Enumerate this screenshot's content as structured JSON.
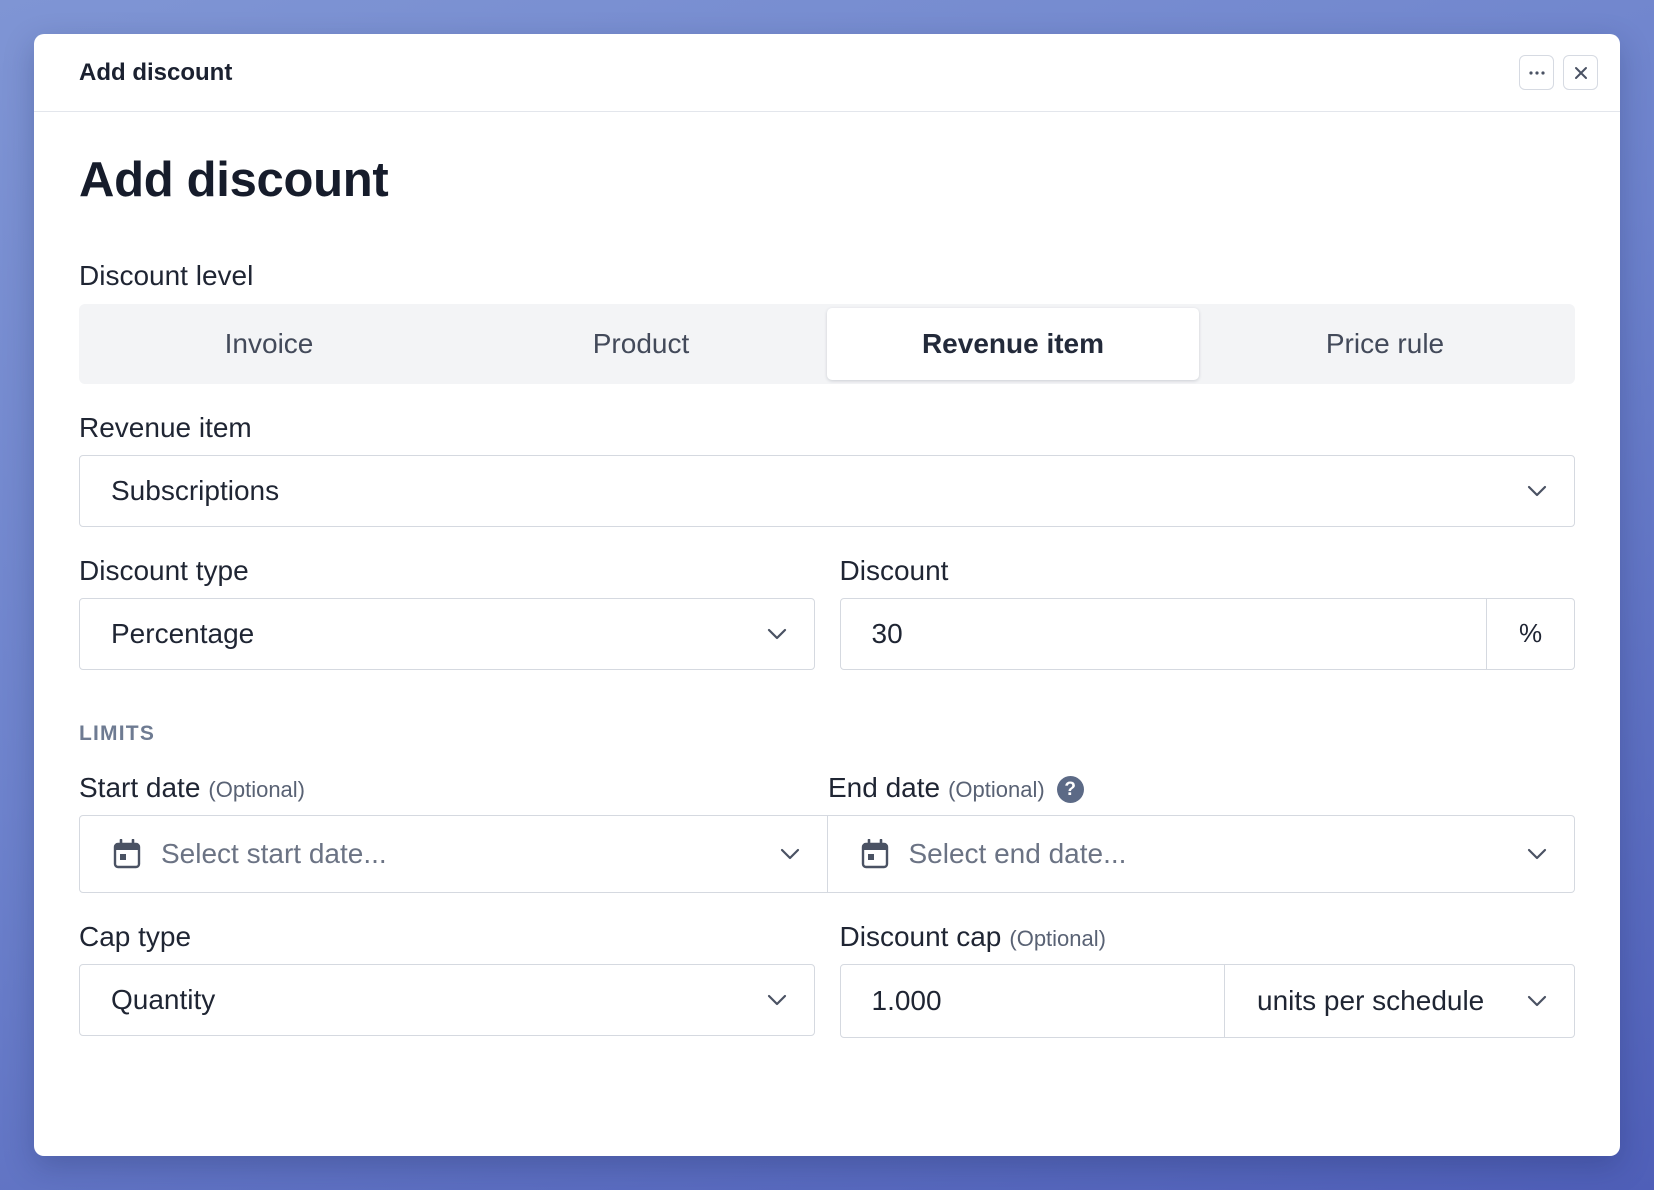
{
  "modal": {
    "header_title": "Add discount",
    "more_icon": "more-horizontal-icon",
    "close_icon": "close-icon"
  },
  "page": {
    "title": "Add discount"
  },
  "discount_level": {
    "label": "Discount level",
    "options": [
      "Invoice",
      "Product",
      "Revenue item",
      "Price rule"
    ],
    "selected": "Revenue item"
  },
  "revenue_item": {
    "label": "Revenue item",
    "value": "Subscriptions"
  },
  "discount_type": {
    "label": "Discount type",
    "value": "Percentage"
  },
  "discount": {
    "label": "Discount",
    "value": "30",
    "suffix": "%"
  },
  "limits": {
    "caption": "LIMITS",
    "start_date": {
      "label": "Start date",
      "optional": "(Optional)",
      "placeholder": "Select start date..."
    },
    "end_date": {
      "label": "End date",
      "optional": "(Optional)",
      "help": "?",
      "placeholder": "Select end date..."
    },
    "cap_type": {
      "label": "Cap type",
      "value": "Quantity"
    },
    "discount_cap": {
      "label": "Discount cap",
      "optional": "(Optional)",
      "value": "1.000",
      "unit": "units per schedule"
    }
  },
  "colors": {
    "background_gradient_start": "#7f95d4",
    "background_gradient_end": "#4f5fb8",
    "text_primary": "#1f2533",
    "caption": "#6e7b92",
    "border": "#d5d9e0"
  }
}
